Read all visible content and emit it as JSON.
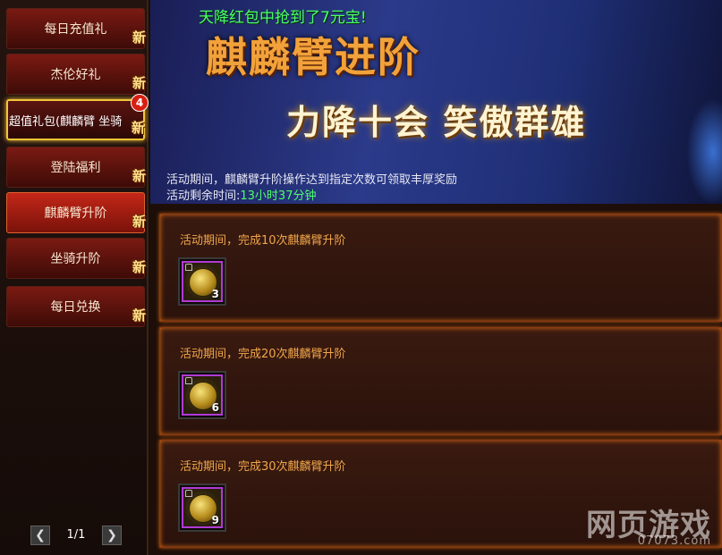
{
  "sidebar": {
    "items": [
      {
        "label": "每日充值礼",
        "tag": "新"
      },
      {
        "label": "杰伦好礼",
        "tag": "新"
      },
      {
        "label": "超值礼包(麒麟臂 坐骑",
        "tag": "新",
        "badge": "4"
      },
      {
        "label": "登陆福利",
        "tag": "新"
      },
      {
        "label": "麒麟臂升阶",
        "tag": "新"
      },
      {
        "label": "坐骑升阶",
        "tag": "新"
      },
      {
        "label": "每日兑换",
        "tag": "新"
      }
    ],
    "pager": {
      "prev": "❮",
      "text": "1/1",
      "next": "❯"
    }
  },
  "banner": {
    "notice": "天降红包中抢到了7元宝!",
    "title": "麒麟臂进阶",
    "subtitle": "力降十会 笑傲群雄",
    "description": "活动期间，麒麟臂升阶操作达到指定次数可领取丰厚奖励",
    "time_label": "活动剩余时间:",
    "time_value": "13小时37分钟"
  },
  "tasks": [
    {
      "label": "活动期间，完成10次麒麟臂升阶",
      "reward_count": "3"
    },
    {
      "label": "活动期间，完成20次麒麟臂升阶",
      "reward_count": "6"
    },
    {
      "label": "活动期间，完成30次麒麟臂升阶",
      "reward_count": "9"
    }
  ],
  "watermark": {
    "main": "网页游戏",
    "sub": "07073.com"
  },
  "colors": {
    "accent_green": "#4dff6a",
    "task_text": "#f0a64a",
    "active_item": "#c32718",
    "highlight_gold": "#f3c43a"
  }
}
